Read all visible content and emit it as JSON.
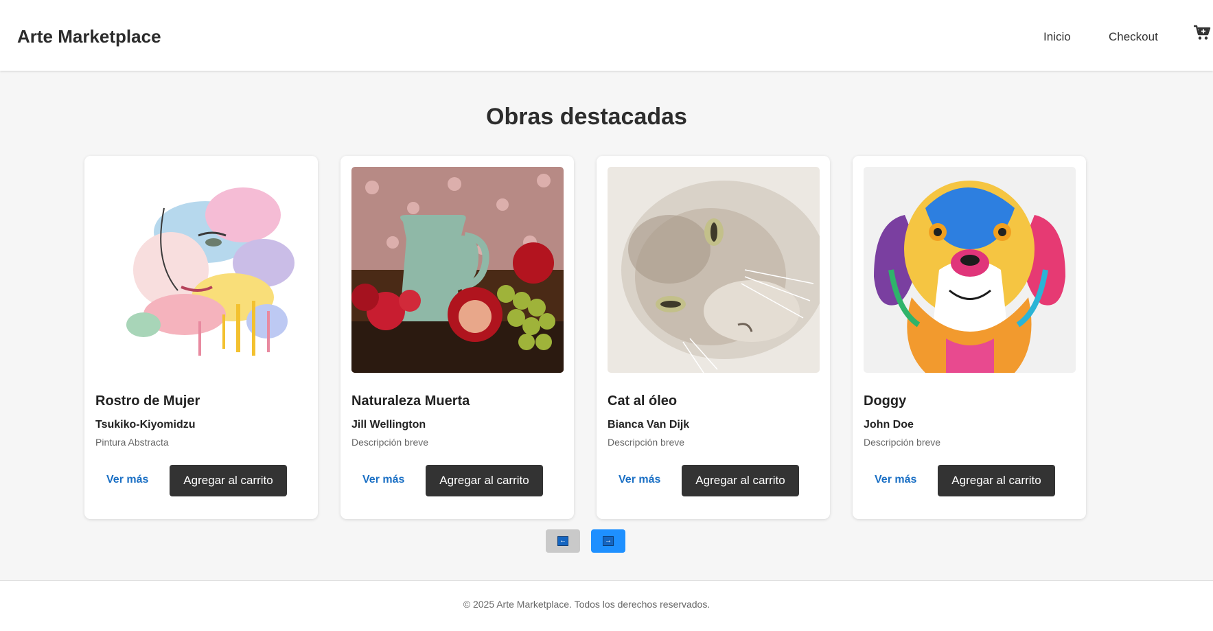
{
  "header": {
    "brand": "Arte Marketplace",
    "nav": [
      {
        "label": "Inicio"
      },
      {
        "label": "Checkout"
      }
    ],
    "cart_icon": "cart-plus-icon"
  },
  "main": {
    "title": "Obras destacadas",
    "cards": [
      {
        "title": "Rostro de Mujer",
        "artist": "Tsukiko-Kiyomidzu",
        "description": "Pintura Abstracta",
        "ver_mas": "Ver más",
        "add_to_cart": "Agregar al carrito"
      },
      {
        "title": "Naturaleza Muerta",
        "artist": "Jill Wellington",
        "description": "Descripción breve",
        "ver_mas": "Ver más",
        "add_to_cart": "Agregar al carrito"
      },
      {
        "title": "Cat al óleo",
        "artist": "Bianca Van Dijk",
        "description": "Descripción breve",
        "ver_mas": "Ver más",
        "add_to_cart": "Agregar al carrito"
      },
      {
        "title": "Doggy",
        "artist": "John Doe",
        "description": "Descripción breve",
        "ver_mas": "Ver más",
        "add_to_cart": "Agregar al carrito"
      }
    ],
    "pager": {
      "prev_icon": "arrow-left-icon",
      "next_icon": "arrow-right-icon",
      "prev_glyph": "←",
      "next_glyph": "→"
    }
  },
  "footer": {
    "text": "© 2025 Arte Marketplace. Todos los derechos reservados."
  },
  "colors": {
    "accent": "#1e90ff",
    "link": "#1a6fc4",
    "button": "#333333",
    "page_bg": "#f6f6f6"
  }
}
